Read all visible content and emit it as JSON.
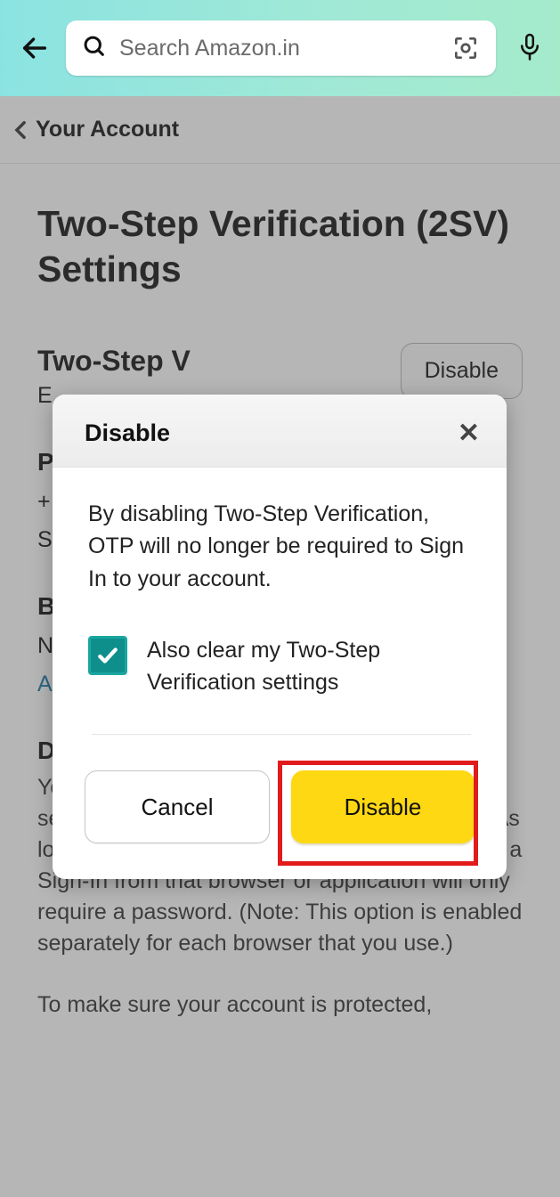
{
  "header": {
    "search_placeholder": "Search Amazon.in"
  },
  "breadcrumb": {
    "label": "Your Account"
  },
  "page": {
    "title": "Two-Step Verification (2SV) Settings",
    "section_heading": "Two-Step V",
    "status_initial": "E",
    "disable_pill": "Disable",
    "label_p": "P",
    "line_plus": "+",
    "line_s": "S",
    "label_b": "B",
    "line_n": "N",
    "line_a": "A",
    "label_d": "D",
    "paragraph1": "You may suppress future OTP challenges by selecting \"Don't require OTP on this browser\". As long as the OTP suppression cookie is present, a Sign-In from that browser or application will only require a password. (Note: This option is enabled separately for each browser that you use.)",
    "paragraph2": "To make sure your account is protected,"
  },
  "modal": {
    "title": "Disable",
    "body": "By disabling Two-Step Verification, OTP will no longer be required to Sign In to your account.",
    "checkbox_label": "Also clear my Two-Step Verification settings",
    "cancel": "Cancel",
    "confirm": "Disable"
  }
}
